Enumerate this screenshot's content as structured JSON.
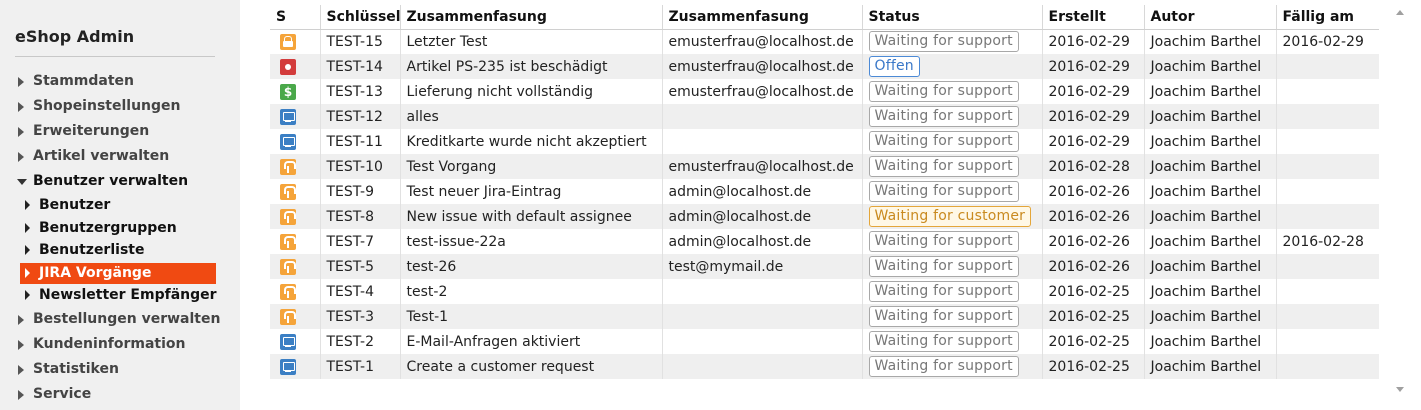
{
  "app": {
    "title": "eShop Admin"
  },
  "sidebar": {
    "items": [
      {
        "label": "Stammdaten",
        "open": false
      },
      {
        "label": "Shopeinstellungen",
        "open": false
      },
      {
        "label": "Erweiterungen",
        "open": false
      },
      {
        "label": "Artikel verwalten",
        "open": false
      },
      {
        "label": "Benutzer verwalten",
        "open": true,
        "children": [
          {
            "label": "Benutzer",
            "active": false
          },
          {
            "label": "Benutzergruppen",
            "active": false
          },
          {
            "label": "Benutzerliste",
            "active": false
          },
          {
            "label": "JIRA Vorgänge",
            "active": true
          },
          {
            "label": "Newsletter Empfänger",
            "active": false
          }
        ]
      },
      {
        "label": "Bestellungen verwalten",
        "open": false
      },
      {
        "label": "Kundeninformation",
        "open": false
      },
      {
        "label": "Statistiken",
        "open": false
      },
      {
        "label": "Service",
        "open": false
      }
    ]
  },
  "table": {
    "columns": [
      "S",
      "Schlüssel",
      "Zusammenfasung",
      "Zusammenfasung",
      "Status",
      "Erstellt",
      "Autor",
      "Fällig am"
    ],
    "rows": [
      {
        "icon": "lock-icon",
        "key": "TEST-15",
        "summary": "Letzter Test",
        "email": "emusterfrau@localhost.de",
        "status": "Waiting for support",
        "status_style": "gray",
        "created": "2016-02-29",
        "author": "Joachim Barthel",
        "due": "2016-02-29"
      },
      {
        "icon": "bug-icon",
        "key": "TEST-14",
        "summary": "Artikel PS-235 ist beschädigt",
        "email": "emusterfrau@localhost.de",
        "status": "Offen",
        "status_style": "blue",
        "created": "2016-02-29",
        "author": "Joachim Barthel",
        "due": ""
      },
      {
        "icon": "dollar-icon",
        "key": "TEST-13",
        "summary": "Lieferung nicht vollständig",
        "email": "emusterfrau@localhost.de",
        "status": "Waiting for support",
        "status_style": "gray",
        "created": "2016-02-29",
        "author": "Joachim Barthel",
        "due": ""
      },
      {
        "icon": "monitor-icon",
        "key": "TEST-12",
        "summary": "alles",
        "email": "",
        "status": "Waiting for support",
        "status_style": "gray",
        "created": "2016-02-29",
        "author": "Joachim Barthel",
        "due": ""
      },
      {
        "icon": "monitor-icon",
        "key": "TEST-11",
        "summary": "Kreditkarte wurde nicht akzeptiert",
        "email": "",
        "status": "Waiting for support",
        "status_style": "gray",
        "created": "2016-02-29",
        "author": "Joachim Barthel",
        "due": ""
      },
      {
        "icon": "tool-icon",
        "key": "TEST-10",
        "summary": "Test Vorgang",
        "email": "emusterfrau@localhost.de",
        "status": "Waiting for support",
        "status_style": "gray",
        "created": "2016-02-28",
        "author": "Joachim Barthel",
        "due": ""
      },
      {
        "icon": "tool-icon",
        "key": "TEST-9",
        "summary": "Test neuer Jira-Eintrag",
        "email": "admin@localhost.de",
        "status": "Waiting for support",
        "status_style": "gray",
        "created": "2016-02-26",
        "author": "Joachim Barthel",
        "due": ""
      },
      {
        "icon": "tool-icon",
        "key": "TEST-8",
        "summary": "New issue with default assignee",
        "email": "admin@localhost.de",
        "status": "Waiting for customer",
        "status_style": "orange",
        "created": "2016-02-26",
        "author": "Joachim Barthel",
        "due": ""
      },
      {
        "icon": "tool-icon",
        "key": "TEST-7",
        "summary": "test-issue-22a",
        "email": "admin@localhost.de",
        "status": "Waiting for support",
        "status_style": "gray",
        "created": "2016-02-26",
        "author": "Joachim Barthel",
        "due": "2016-02-28"
      },
      {
        "icon": "tool-icon",
        "key": "TEST-5",
        "summary": "test-26",
        "email": "test@mymail.de",
        "status": "Waiting for support",
        "status_style": "gray",
        "created": "2016-02-26",
        "author": "Joachim Barthel",
        "due": ""
      },
      {
        "icon": "tool-icon",
        "key": "TEST-4",
        "summary": "test-2",
        "email": "",
        "status": "Waiting for support",
        "status_style": "gray",
        "created": "2016-02-25",
        "author": "Joachim Barthel",
        "due": ""
      },
      {
        "icon": "tool-icon",
        "key": "TEST-3",
        "summary": "Test-1",
        "email": "",
        "status": "Waiting for support",
        "status_style": "gray",
        "created": "2016-02-25",
        "author": "Joachim Barthel",
        "due": ""
      },
      {
        "icon": "monitor-icon",
        "key": "TEST-2",
        "summary": "E-Mail-Anfragen aktiviert",
        "email": "",
        "status": "Waiting for support",
        "status_style": "gray",
        "created": "2016-02-25",
        "author": "Joachim Barthel",
        "due": ""
      },
      {
        "icon": "monitor-icon",
        "key": "TEST-1",
        "summary": "Create a customer request",
        "email": "",
        "status": "Waiting for support",
        "status_style": "gray",
        "created": "2016-02-25",
        "author": "Joachim Barthel",
        "due": ""
      }
    ]
  },
  "colors": {
    "accent": "#f04a12",
    "status_blue": "#3a78c8",
    "status_orange": "#c98a1f"
  }
}
